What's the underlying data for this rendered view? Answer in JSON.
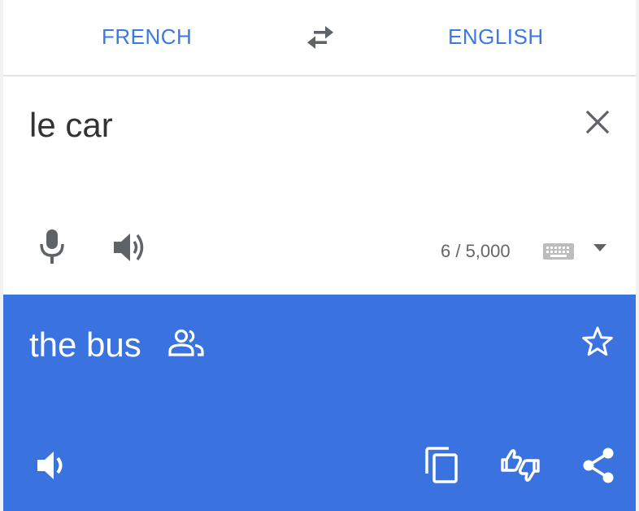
{
  "languages": {
    "source": "FRENCH",
    "target": "ENGLISH"
  },
  "input": {
    "text": "le car",
    "char_count": "6 / 5,000"
  },
  "output": {
    "text": "the bus"
  },
  "colors": {
    "accent": "#3b78e7",
    "output_background": "#3a73e0",
    "icon_gray": "#5f6368"
  },
  "icons": {
    "swap": "swap-arrows-icon",
    "clear": "close-icon",
    "mic": "microphone-icon",
    "speaker": "volume-icon",
    "keyboard": "keyboard-icon",
    "dropdown": "caret-down-icon",
    "community": "people-icon",
    "star": "star-outline-icon",
    "copy": "copy-icon",
    "feedback": "thumbs-feedback-icon",
    "share": "share-icon"
  }
}
